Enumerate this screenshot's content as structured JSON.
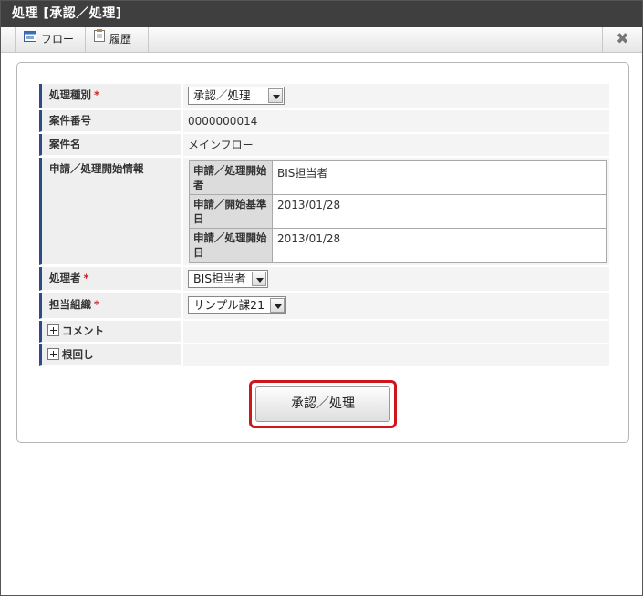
{
  "window": {
    "title": "処理 [承認／処理]",
    "close_symbol": "✖"
  },
  "toolbar": {
    "flow_label": "フロー",
    "history_label": "履歴"
  },
  "form": {
    "process_type": {
      "label": "処理種別",
      "required_mark": "*",
      "selected": "承認／処理"
    },
    "case_number": {
      "label": "案件番号",
      "value": "0000000014"
    },
    "case_name": {
      "label": "案件名",
      "value": "メインフロー"
    },
    "application_info": {
      "label": "申請／処理開始情報",
      "rows": [
        {
          "label": "申請／処理開始者",
          "value": "BIS担当者"
        },
        {
          "label": "申請／開始基準日",
          "value": "2013/01/28"
        },
        {
          "label": "申請／処理開始日",
          "value": "2013/01/28"
        }
      ]
    },
    "processor": {
      "label": "処理者",
      "required_mark": "*",
      "selected": "BIS担当者"
    },
    "organization": {
      "label": "担当組織",
      "required_mark": "*",
      "selected": "サンプル課21"
    },
    "comment": {
      "label": "コメント"
    },
    "nemawashi": {
      "label": "根回し"
    }
  },
  "submit_label": "承認／処理"
}
